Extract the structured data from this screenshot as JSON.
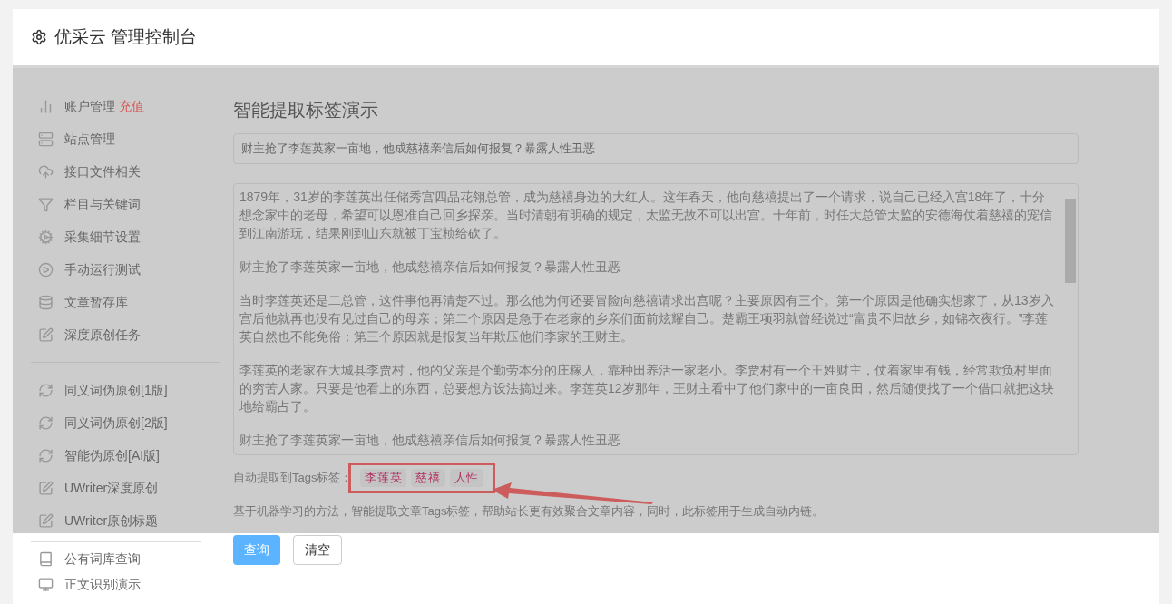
{
  "header": {
    "title": "优采云 管理控制台"
  },
  "sidebar": {
    "groups": [
      {
        "items": [
          {
            "label": "账户管理",
            "badge": "充值"
          },
          {
            "label": "站点管理"
          },
          {
            "label": "接口文件相关"
          },
          {
            "label": "栏目与关键词"
          },
          {
            "label": "采集细节设置"
          },
          {
            "label": "手动运行测试"
          },
          {
            "label": "文章暂存库"
          },
          {
            "label": "深度原创任务"
          }
        ]
      },
      {
        "items": [
          {
            "label": "同义词伪原创[1版]"
          },
          {
            "label": "同义词伪原创[2版]"
          },
          {
            "label": "智能伪原创[AI版]"
          },
          {
            "label": "UWriter深度原创"
          },
          {
            "label": "UWriter原创标题"
          }
        ]
      },
      {
        "items": [
          {
            "label": "公有词库查询"
          },
          {
            "label": "正文识别演示"
          }
        ]
      }
    ]
  },
  "main": {
    "title": "智能提取标签演示",
    "title_field": {
      "value": "财主抢了李莲英家一亩地，他成慈禧亲信后如何报复？暴露人性丑恶"
    },
    "article": [
      "1879年，31岁的李莲英出任储秀宫四品花翎总管，成为慈禧身边的大红人。这年春天，他向慈禧提出了一个请求，说自己已经入宫18年了，十分想念家中的老母，希望可以恩准自己回乡探亲。当时清朝有明确的规定，太监无故不可以出宫。十年前，时任大总管太监的安德海仗着慈禧的宠信到江南游玩，结果刚到山东就被丁宝桢给砍了。",
      "财主抢了李莲英家一亩地，他成慈禧亲信后如何报复？暴露人性丑恶",
      "当时李莲英还是二总管，这件事他再清楚不过。那么他为何还要冒险向慈禧请求出宫呢？主要原因有三个。第一个原因是他确实想家了，从13岁入宫后他就再也没有见过自己的母亲；第二个原因是急于在老家的乡亲们面前炫耀自己。楚霸王项羽就曾经说过“富贵不归故乡，如锦衣夜行。”李莲英自然也不能免俗；第三个原因就是报复当年欺压他们李家的王财主。",
      "李莲英的老家在大城县李贾村，他的父亲是个勤劳本分的庄稼人，靠种田养活一家老小。李贾村有一个王姓财主，仗着家里有钱，经常欺负村里面的穷苦人家。只要是他看上的东西，总要想方设法搞过来。李莲英12岁那年，王财主看中了他们家中的一亩良田，然后随便找了一个借口就把这块地给霸占了。",
      "财主抢了李莲英家一亩地，他成慈禧亲信后如何报复？暴露人性丑恶"
    ],
    "tags_label": "自动提取到Tags标签：",
    "tags": [
      "李莲英",
      "慈禧",
      "人性"
    ],
    "description": "基于机器学习的方法，智能提取文章Tags标签，帮助站长更有效聚合文章内容，同时，此标签用于生成自动内链。",
    "buttons": [
      {
        "label": "查询",
        "kind": "primary"
      },
      {
        "label": "清空",
        "kind": "default"
      }
    ]
  }
}
